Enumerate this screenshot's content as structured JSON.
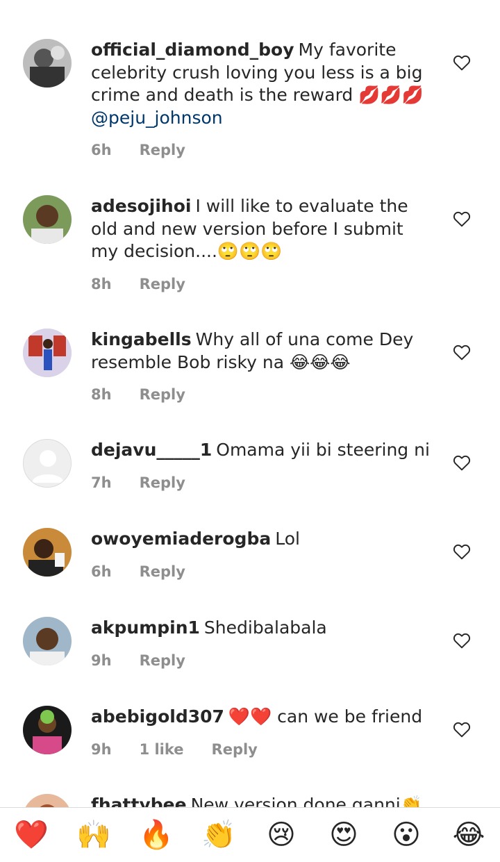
{
  "comments": [
    {
      "username": "official_diamond_boy",
      "text": "My favorite celebrity crush loving you less is a big crime and death is the reward 💋💋💋",
      "mention": "@peju_johnson",
      "time": "6h",
      "likes": "",
      "reply": "Reply",
      "avatar_icon": "avatar-photo-grayscale"
    },
    {
      "username": "adesojihoi",
      "text": "I will like to evaluate the old and new version before I submit my decision....🙄🙄🙄",
      "time": "8h",
      "likes": "",
      "reply": "Reply",
      "avatar_icon": "avatar-photo"
    },
    {
      "username": "kingabells",
      "text": "Why all of una come Dey resemble Bob risky na 😂😂😂",
      "time": "8h",
      "likes": "",
      "reply": "Reply",
      "avatar_icon": "avatar-photo"
    },
    {
      "username": "dejavu_____1",
      "text": "Omama yii bi steering ni",
      "time": "7h",
      "likes": "",
      "reply": "Reply",
      "avatar_icon": "default-avatar-icon"
    },
    {
      "username": "owoyemiaderogba",
      "text": "Lol",
      "time": "6h",
      "likes": "",
      "reply": "Reply",
      "avatar_icon": "avatar-photo"
    },
    {
      "username": "akpumpin1",
      "text": "Shedibalabala",
      "time": "9h",
      "likes": "",
      "reply": "Reply",
      "avatar_icon": "avatar-photo"
    },
    {
      "username": "abebigold307",
      "text": "❤️❤️ can we be friend",
      "time": "9h",
      "likes": "1 like",
      "reply": "Reply",
      "avatar_icon": "avatar-photo"
    },
    {
      "username": "fhattybee",
      "text": "New version done ganni👏",
      "time": "",
      "likes": "",
      "reply": "",
      "avatar_icon": "avatar-photo"
    }
  ],
  "reactions": [
    "❤️",
    "🙌",
    "🔥",
    "👏",
    "😢",
    "😍",
    "😮",
    "😂"
  ],
  "colors": {
    "text": "#262626",
    "meta": "#8e8e8e",
    "mention": "#00376b",
    "divider": "#dbdbdb"
  }
}
